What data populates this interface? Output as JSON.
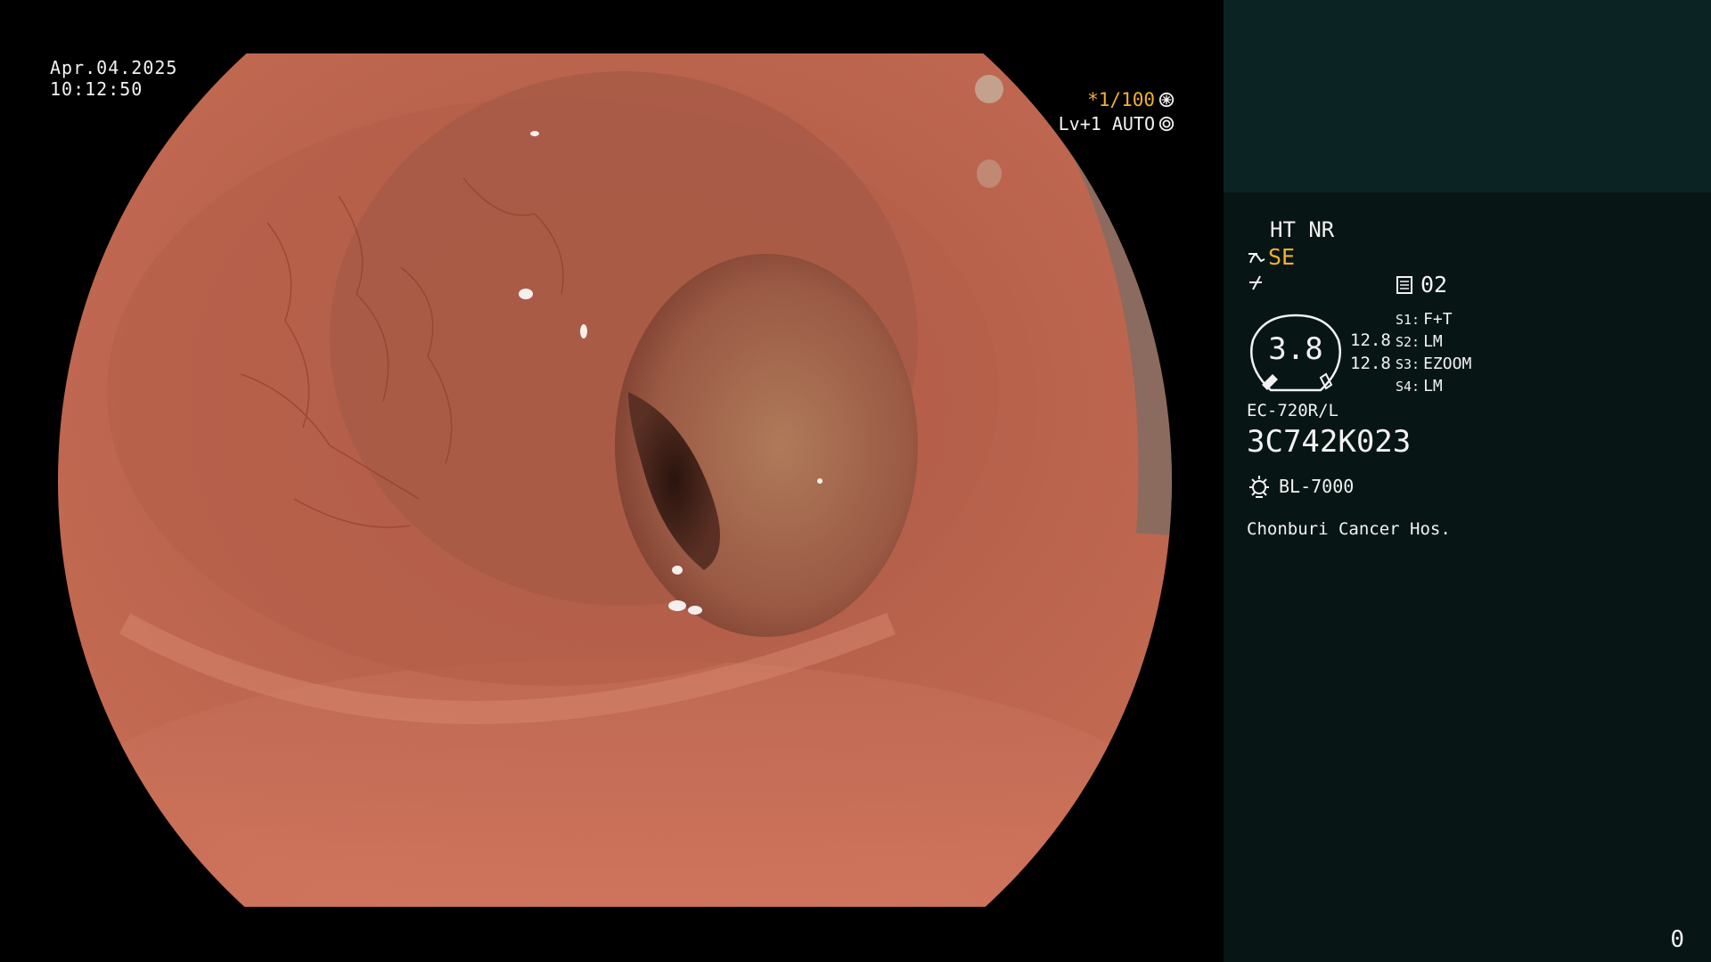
{
  "endoscope_view": {
    "date": "Apr.04.2025",
    "time": "10:12:50",
    "shutter": "*1/100",
    "iris": "Lv+1 AUTO",
    "image_description_icon": "colon-lumen-image"
  },
  "side_panel": {
    "mode": "HT NR",
    "enhancement": "SE",
    "preset": "02",
    "gauge_value": "3.8",
    "gain_top": "12.8",
    "gain_bottom": "12.8",
    "switches": [
      {
        "key": "S1:",
        "value": "F+T"
      },
      {
        "key": "S2:",
        "value": "LM"
      },
      {
        "key": "S3:",
        "value": "EZOOM"
      },
      {
        "key": "S4:",
        "value": "LM"
      }
    ],
    "scope_model": "EC-720R/L",
    "serial": "3C742K023",
    "light_source": "BL-7000",
    "hospital": "Chonburi Cancer Hos.",
    "counter": "0"
  },
  "colors": {
    "accent": "#f0b030",
    "panel_top": "#0c2323",
    "panel_body": "#081515"
  }
}
